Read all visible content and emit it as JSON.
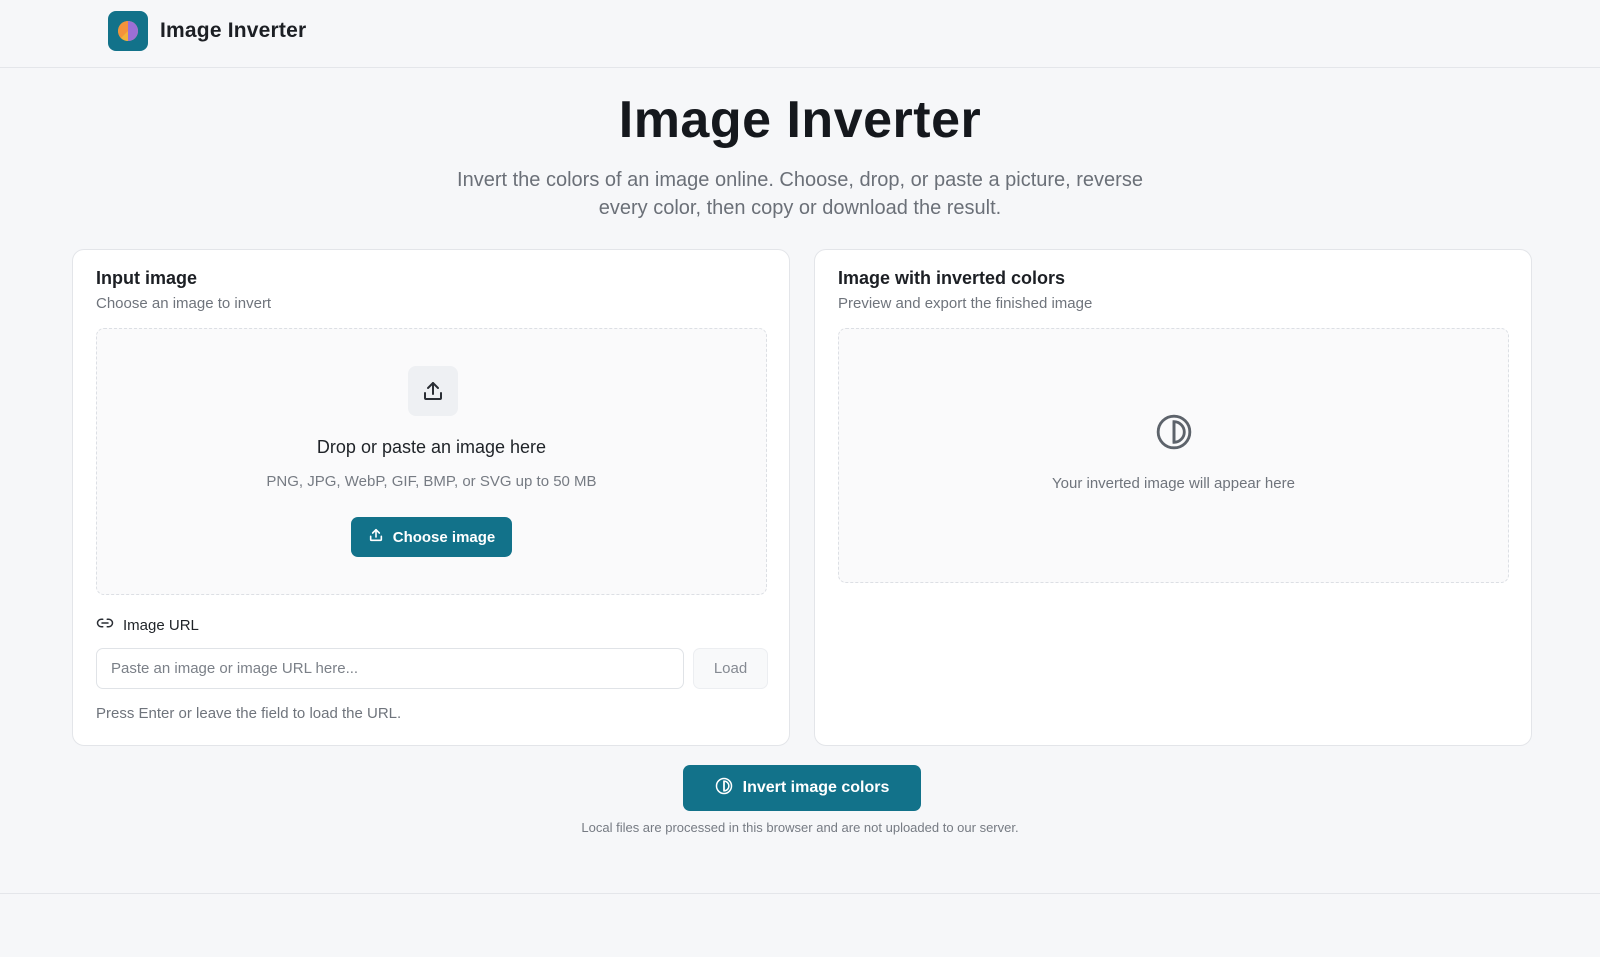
{
  "header": {
    "brand_name": "Image Inverter",
    "logo_icon": "half-circle-logo-icon",
    "accent_color": "#12728a"
  },
  "hero": {
    "title": "Image Inverter",
    "subtitle": "Invert the colors of an image online. Choose, drop, or paste a picture, reverse every color, then copy or download the result."
  },
  "input_card": {
    "title": "Input image",
    "subtitle": "Choose an image to invert",
    "dropzone": {
      "icon": "upload-icon",
      "title": "Drop or paste an image here",
      "hint": "PNG, JPG, WebP, GIF, BMP, or SVG up to 50 MB",
      "button_label": "Choose image"
    },
    "url": {
      "icon": "link-icon",
      "label": "Image URL",
      "placeholder": "Paste an image or image URL here...",
      "value": "",
      "load_label": "Load",
      "hint": "Press Enter or leave the field to load the URL."
    }
  },
  "output_card": {
    "title": "Image with inverted colors",
    "subtitle": "Preview and export the finished image",
    "placeholder_icon": "invert-icon",
    "placeholder_text": "Your inverted image will appear here"
  },
  "actions": {
    "invert_label": "Invert image colors",
    "invert_icon": "invert-icon",
    "footnote": "Local files are processed in this browser and are not uploaded to our server."
  }
}
